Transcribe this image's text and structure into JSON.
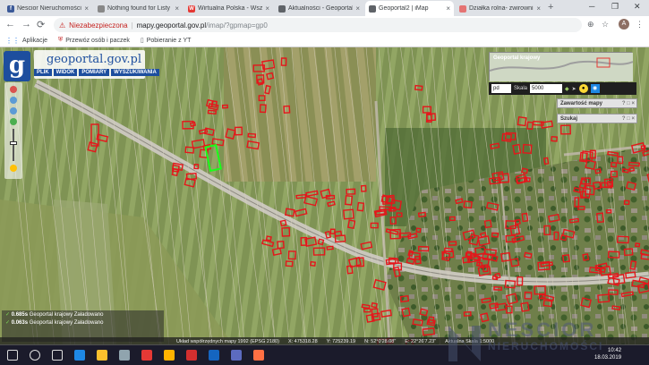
{
  "browser": {
    "tabs": [
      {
        "title": "Nescior Nieruchomości",
        "favicon": "facebook-icon",
        "color": "#3b5998",
        "glyph": "f",
        "active": false
      },
      {
        "title": "Nothing found for Listy",
        "favicon": "page-icon",
        "color": "#888888",
        "glyph": "",
        "active": false
      },
      {
        "title": "Wirtualna Polska - Wszy",
        "favicon": "wp-icon",
        "color": "#e53935",
        "glyph": "W",
        "active": false
      },
      {
        "title": "Aktualności - Geoportal",
        "favicon": "geoportal-icon",
        "color": "#5f6368",
        "glyph": "",
        "active": false
      },
      {
        "title": "Geoportal2 | iMap",
        "favicon": "geoportal-icon",
        "color": "#5f6368",
        "glyph": "",
        "active": true
      },
      {
        "title": "Działka rolna- zwirowni",
        "favicon": "otodom-icon",
        "color": "#e57373",
        "glyph": "",
        "active": false
      }
    ],
    "new_tab": "+",
    "address": {
      "security_label": "Niezabezpieczona",
      "host": "mapy.geoportal.gov.pl",
      "path": "/imap/?gpmap=gp0"
    },
    "bookmarks": [
      {
        "label": "Aplikacje",
        "icon": "apps-grid-icon"
      },
      {
        "label": "Przewóz osób i paczek",
        "icon": "bookmark-shield-icon"
      },
      {
        "label": "Pobieranie z YT",
        "icon": "page-icon"
      }
    ],
    "profile_initial": "A"
  },
  "geoportal": {
    "logo_letter": "g",
    "brand": "geoportal.gov.pl",
    "menu": [
      "PLIK",
      "WIDOK",
      "POMIARY",
      "WYSZUKIWANIA"
    ],
    "minimap_label": "Geoportal krajowy",
    "scale": {
      "unit": "pd",
      "label": "Skala",
      "value": "5000"
    },
    "panels": [
      {
        "label": "Zawartość mapy",
        "buttons": "? □ ×"
      },
      {
        "label": "Szukaj",
        "buttons": "? □ ×"
      }
    ],
    "status_rows": [
      {
        "time": "0.685s",
        "service": "Geoportal krajowy",
        "state": "Załadowano"
      },
      {
        "time": "0.063s",
        "service": "Geoportal krajowy",
        "state": "Załadowano"
      }
    ],
    "statusbar": {
      "crs": "Układ współrzędnych mapy 1992 (EPSG 2180)",
      "x": "X: 475318.28",
      "y": "Y: 725239.19",
      "n": "N: 52°0'28.08\"",
      "e": "E: 22°26'7.23\"",
      "scale": "Aktualna Skala 1:5000"
    }
  },
  "watermark": {
    "line1": "NESCIOR",
    "line2": "NIERUCHOMOŚCI"
  },
  "taskbar": {
    "time": "10:42",
    "date": "18.03.2019",
    "apps": [
      "start-icon",
      "search-icon",
      "taskview-icon",
      "edge-icon",
      "explorer-icon",
      "mail-icon",
      "chrome-icon",
      "folder-icon",
      "opera-icon",
      "word-icon",
      "thunderbird-icon",
      "firefox-icon"
    ]
  }
}
